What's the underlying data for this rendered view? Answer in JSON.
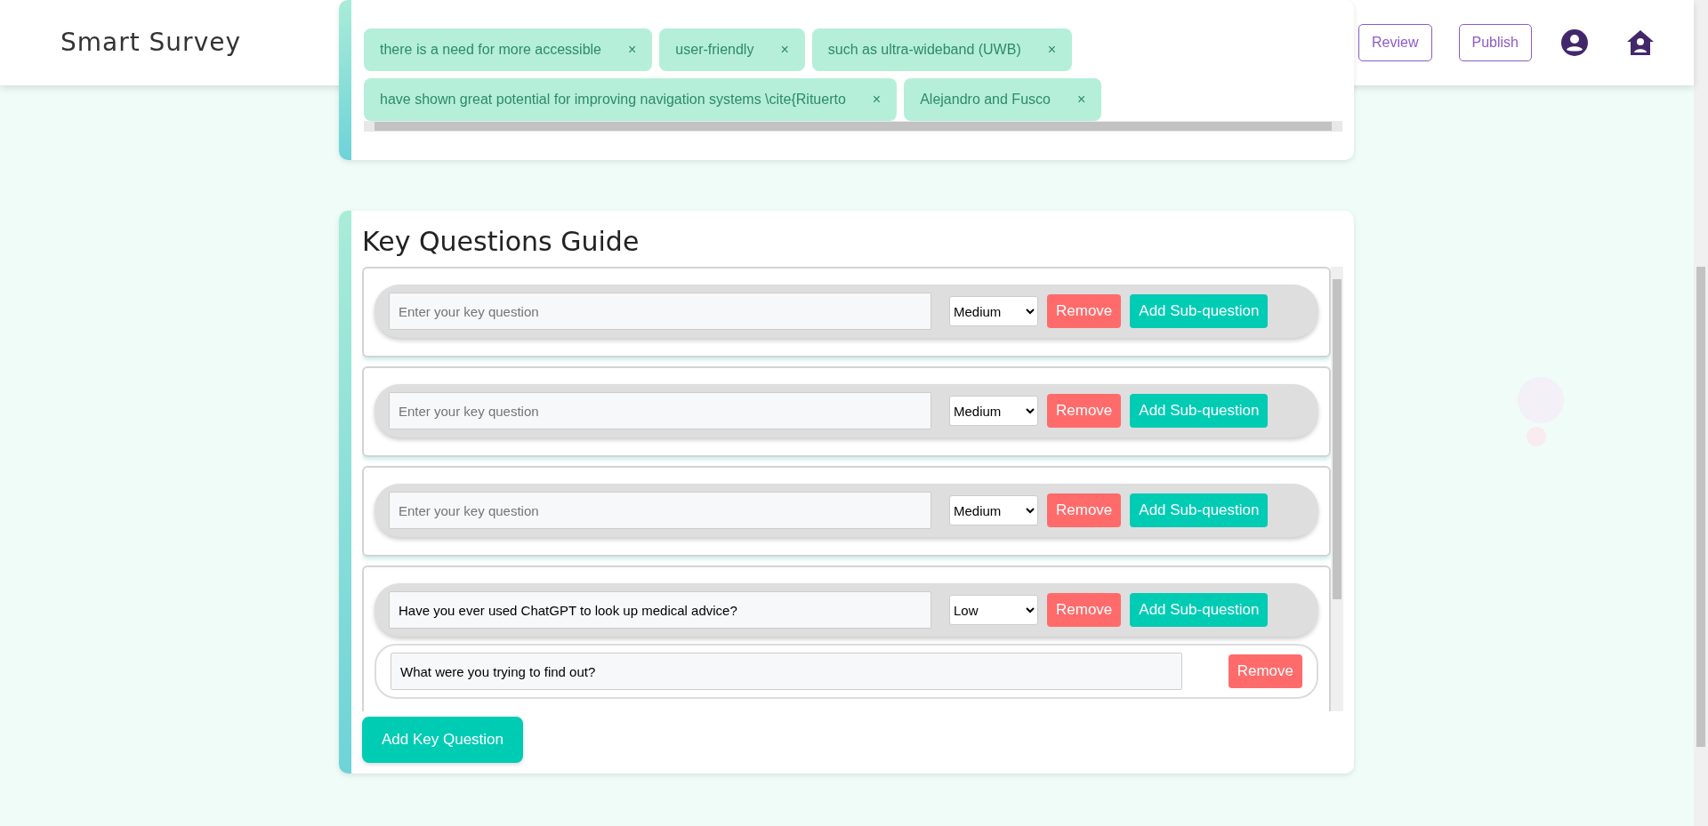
{
  "header": {
    "title": "Smart Survey",
    "buttons": [
      {
        "label": "Review"
      },
      {
        "label": "Publish"
      }
    ]
  },
  "keyword_tags": [
    {
      "label": "there is a need for more accessible",
      "close": "×"
    },
    {
      "label": "user-friendly",
      "close": "×"
    },
    {
      "label": "such as ultra-wideband (UWB)",
      "close": "×"
    },
    {
      "label": "have shown great potential for improving navigation systems \\cite{Rituerto",
      "close": "×"
    },
    {
      "label": "Alejandro and Fusco",
      "close": "×"
    }
  ],
  "key_questions": {
    "title": "Key Questions Guide",
    "questions": [
      {
        "placeholder": "Enter your key question",
        "priority": "Medium",
        "remove": "Remove",
        "add_sub": "Add Sub-question"
      },
      {
        "placeholder": "Enter your key question",
        "priority": "Medium",
        "remove": "Remove",
        "add_sub": "Add Sub-question"
      },
      {
        "placeholder": "Enter your key question",
        "priority": "Medium",
        "remove": "Remove",
        "add_sub": "Add Sub-question"
      },
      {
        "value": "Have you ever used ChatGPT to look up medical advice?",
        "priority": "Low",
        "remove": "Remove",
        "add_sub": "Add Sub-question",
        "sub_questions": [
          {
            "value": "What were you trying to find out?",
            "remove": "Remove"
          }
        ]
      }
    ],
    "add_button": "Add Key Question"
  }
}
